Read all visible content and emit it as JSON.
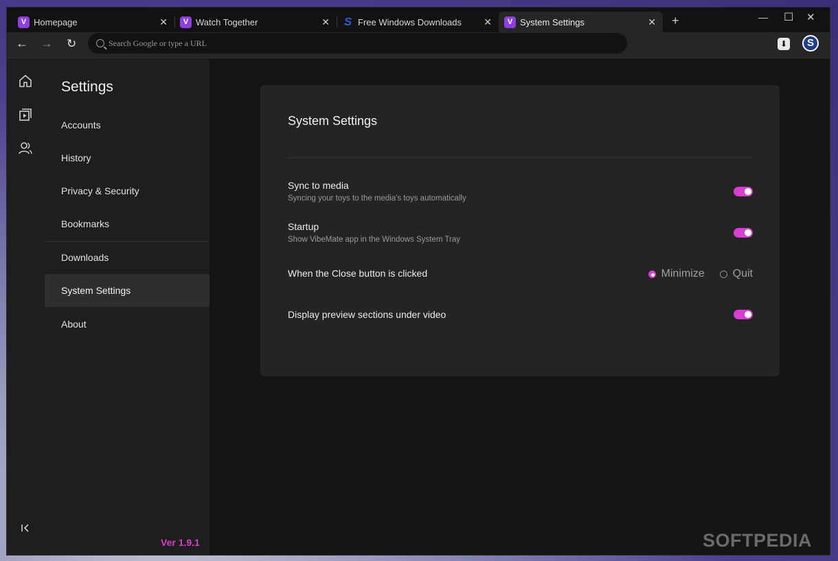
{
  "tabs": [
    {
      "title": "Homepage",
      "favicon": "vibemate-icon"
    },
    {
      "title": "Watch Together",
      "favicon": "vibemate-icon"
    },
    {
      "title": "Free Windows Downloads",
      "favicon": "softpedia-s-icon"
    },
    {
      "title": "System Settings",
      "favicon": "vibemate-icon",
      "active": true
    }
  ],
  "toolbar": {
    "url_placeholder": "Search Google or type a URL",
    "profile_initial": "S"
  },
  "settings": {
    "title": "Settings",
    "nav": [
      "Accounts",
      "History",
      "Privacy & Security",
      "Bookmarks",
      "Downloads",
      "System Settings",
      "About"
    ],
    "active": "System Settings",
    "version": "Ver 1.9.1"
  },
  "system_settings": {
    "title": "System Settings",
    "sync": {
      "label": "Sync to media",
      "desc": "Syncing your toys to the media's toys automatically",
      "enabled": true
    },
    "startup": {
      "label": "Startup",
      "desc": "Show VibeMate app in the Windows System Tray",
      "enabled": true
    },
    "close_behavior": {
      "label": "When the Close button is clicked",
      "options": [
        "Minimize",
        "Quit"
      ],
      "selected": "Minimize"
    },
    "preview": {
      "label": "Display preview sections under video",
      "enabled": true
    }
  },
  "watermark": "SOFTPEDIA",
  "colors": {
    "accent": "#d63fd0",
    "favicon": "#8e3fe0"
  }
}
